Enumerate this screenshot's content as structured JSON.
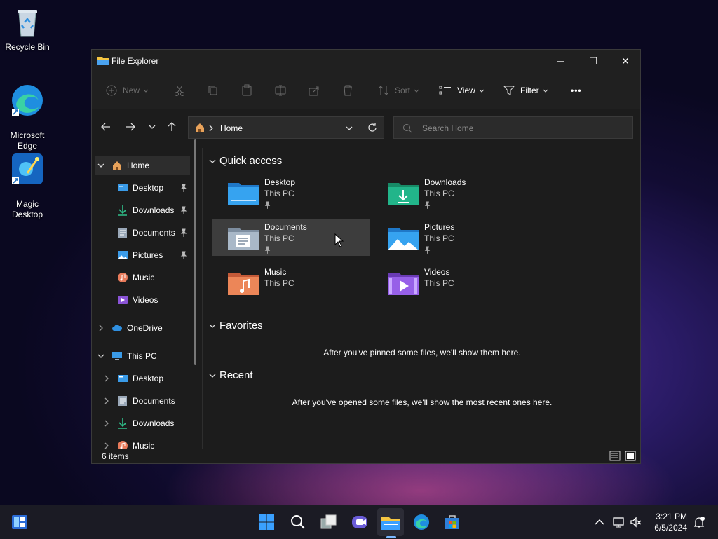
{
  "desktop": {
    "icons": [
      {
        "label": "Recycle Bin"
      },
      {
        "label": "Microsoft\nEdge"
      },
      {
        "label": "Magic\nDesktop"
      }
    ]
  },
  "window": {
    "title": "File Explorer",
    "controls": {
      "minimize": "─",
      "maximize": "☐",
      "close": "✕"
    }
  },
  "toolbar": {
    "new_label": "New",
    "sort_label": "Sort",
    "view_label": "View",
    "filter_label": "Filter",
    "more_label": "•••"
  },
  "address": {
    "location": "Home"
  },
  "search": {
    "placeholder": "Search Home"
  },
  "sidebar": {
    "home": "Home",
    "quick": [
      "Desktop",
      "Downloads",
      "Documents",
      "Pictures",
      "Music",
      "Videos"
    ],
    "onedrive": "OneDrive",
    "thispc": "This PC",
    "pc_children": [
      "Desktop",
      "Documents",
      "Downloads",
      "Music"
    ]
  },
  "content": {
    "quick_access_title": "Quick access",
    "favorites_title": "Favorites",
    "recent_title": "Recent",
    "favorites_empty": "After you've pinned some files, we'll show them here.",
    "recent_empty": "After you've opened some files, we'll show the most recent ones here.",
    "folders": [
      {
        "name": "Desktop",
        "location": "This PC",
        "pinned": true
      },
      {
        "name": "Downloads",
        "location": "This PC",
        "pinned": true
      },
      {
        "name": "Documents",
        "location": "This PC",
        "pinned": true
      },
      {
        "name": "Pictures",
        "location": "This PC",
        "pinned": true
      },
      {
        "name": "Music",
        "location": "This PC",
        "pinned": false
      },
      {
        "name": "Videos",
        "location": "This PC",
        "pinned": false
      }
    ]
  },
  "statusbar": {
    "items": "6 items"
  },
  "taskbar": {
    "time": "3:21 PM",
    "date": "6/5/2024"
  },
  "colors": {
    "accent": "#0078d4",
    "folder_blue": "#2f8fe0",
    "folder_green": "#22a37a",
    "folder_orange": "#e8744a",
    "folder_purple": "#8a53d6"
  }
}
